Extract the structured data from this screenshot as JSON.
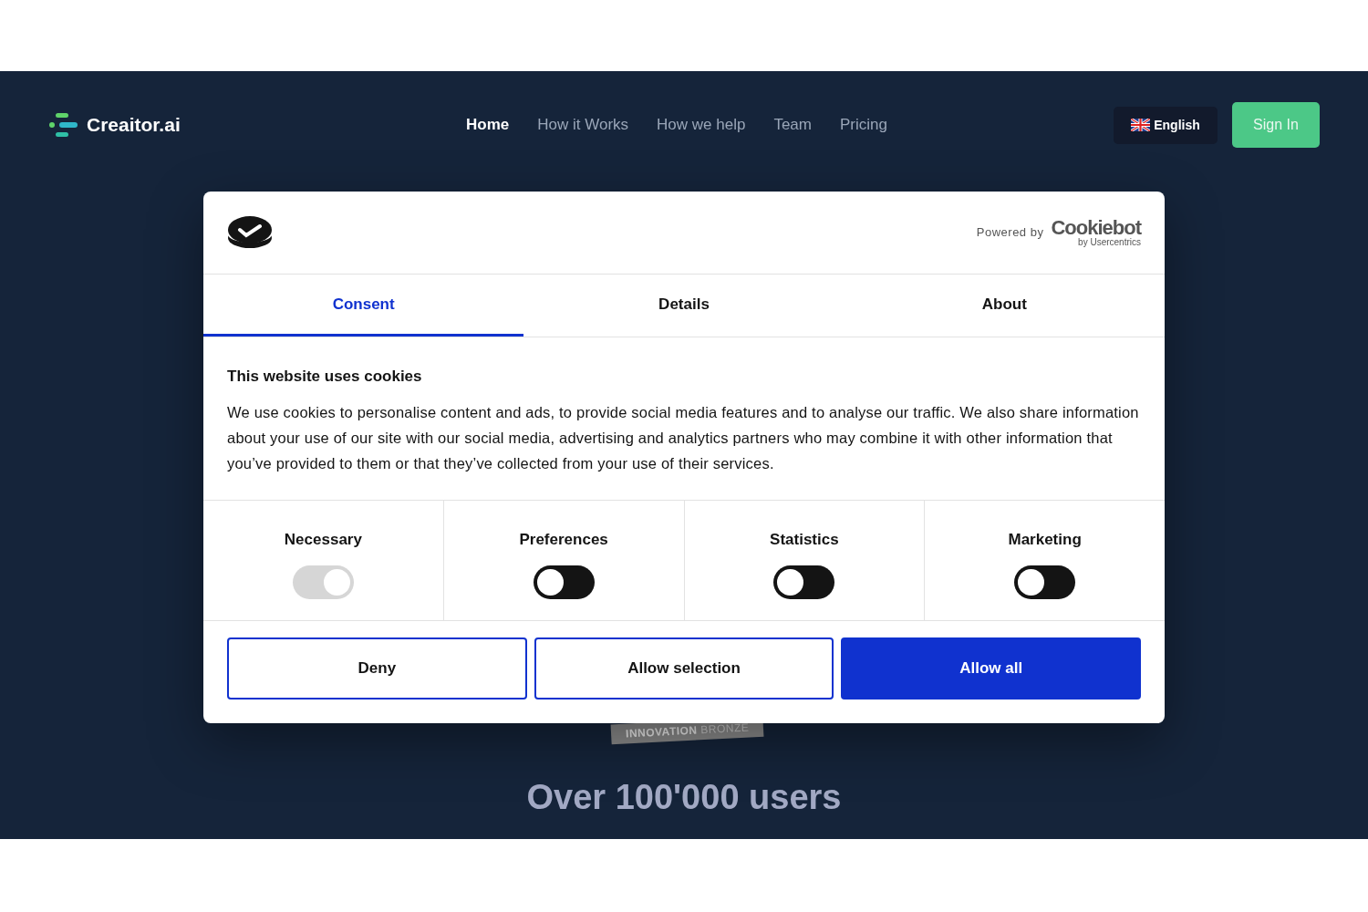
{
  "nav": {
    "brand": "Creaitor.ai",
    "links": [
      {
        "label": "Home",
        "selected": true
      },
      {
        "label": "How it Works",
        "selected": false
      },
      {
        "label": "How we help",
        "selected": false
      },
      {
        "label": "Team",
        "selected": false
      },
      {
        "label": "Pricing",
        "selected": false
      }
    ],
    "language": "English",
    "sign_in": "Sign In"
  },
  "dialog": {
    "powered_by": "Powered by",
    "provider": "Cookiebot",
    "provider_sub": "by Usercentrics",
    "tabs": [
      {
        "label": "Consent",
        "selected": true
      },
      {
        "label": "Details",
        "selected": false
      },
      {
        "label": "About",
        "selected": false
      }
    ],
    "title": "This website uses cookies",
    "body": "We use cookies to personalise content and ads, to provide social media features and to analyse our traffic. We also share information about your use of our site with our social media, advertising and analytics partners who may combine it with other information that you’ve provided to them or that they’ve collected from your use of their services.",
    "toggles": [
      {
        "label": "Necessary",
        "on": true,
        "disabled": true
      },
      {
        "label": "Preferences",
        "on": false,
        "disabled": false
      },
      {
        "label": "Statistics",
        "on": false,
        "disabled": false
      },
      {
        "label": "Marketing",
        "on": false,
        "disabled": false
      }
    ],
    "buttons": [
      {
        "label": "Deny",
        "kind": "outline"
      },
      {
        "label": "Allow selection",
        "kind": "outline"
      },
      {
        "label": "Allow all",
        "kind": "primary"
      }
    ]
  },
  "badge": {
    "text_1": "INNOVATION",
    "text_2": "BRONZE"
  },
  "headline": "Over 100'000 users"
}
